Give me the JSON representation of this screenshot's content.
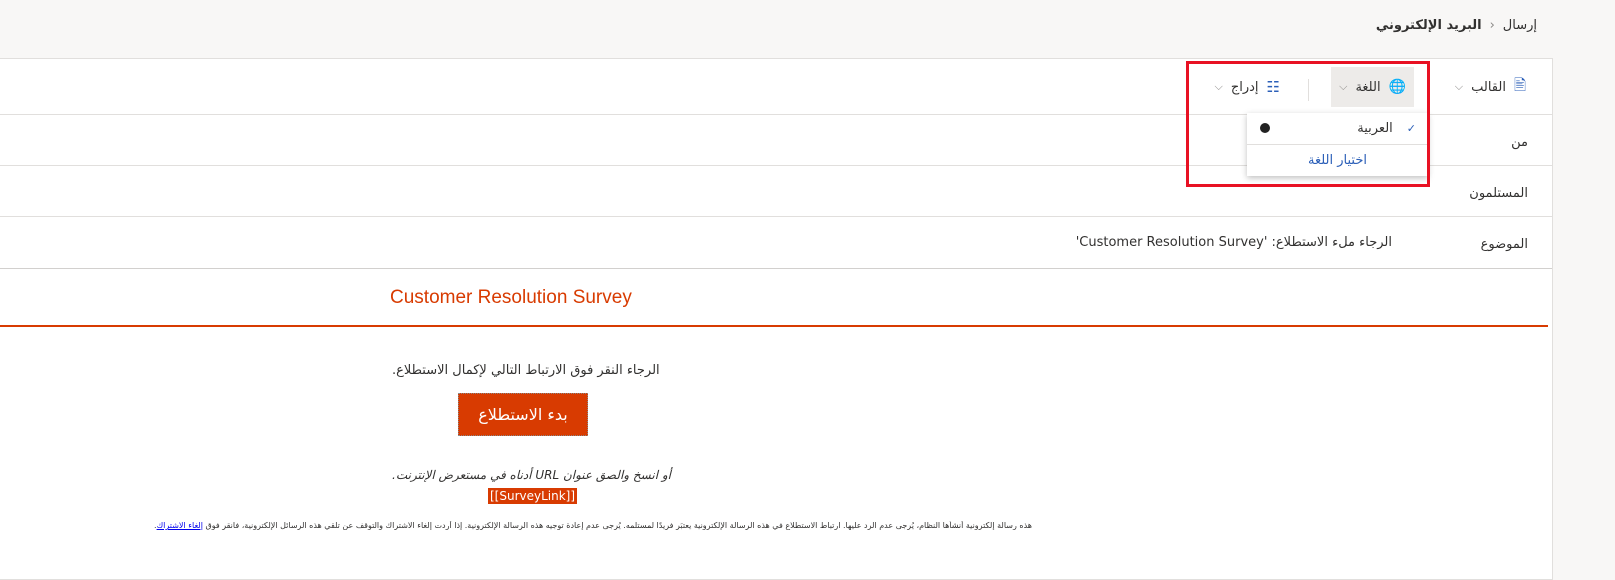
{
  "breadcrumb": {
    "parent": "إرسال",
    "current": "البريد الإلكتروني"
  },
  "toolbar": {
    "template": "القالب",
    "language": "اللغة",
    "insert": "إدراج"
  },
  "language_menu": {
    "selected": "العربية",
    "choose": "اختيار اللغة"
  },
  "fields": {
    "from_label": "من",
    "recipients_label": "المستلمون",
    "subject_label": "الموضوع",
    "subject_value": "الرجاء ملء الاستطلاع: 'Customer Resolution Survey'"
  },
  "body": {
    "title": "Customer Resolution Survey",
    "instruction": "الرجاء النقر فوق الارتباط التالي لإكمال الاستطلاع.",
    "start_button": "بدء الاستطلاع",
    "copy_text": "أو انسخ والصق عنوان URL أدناه في مستعرض الإنترنت.",
    "survey_link": "[[SurveyLink]]",
    "footer": "هذه رسالة إلكترونية أنشأها النظام، يُرجى عدم الرد عليها. ارتباط الاستطلاع في هذه الرسالة الإلكترونية يعتبَر فريدًا لمستلمه. يُرجى عدم إعادة توجيه هذه الرسالة الإلكترونية. إذا أردت إلغاء الاشتراك والتوقف عن تلقي هذه الرسائل الإلكترونية، فانقر فوق",
    "unsubscribe": "إلغاء الاشتراك"
  },
  "colors": {
    "accent": "#d83b01",
    "highlight": "#e81123",
    "link": "#2b5fb8"
  }
}
